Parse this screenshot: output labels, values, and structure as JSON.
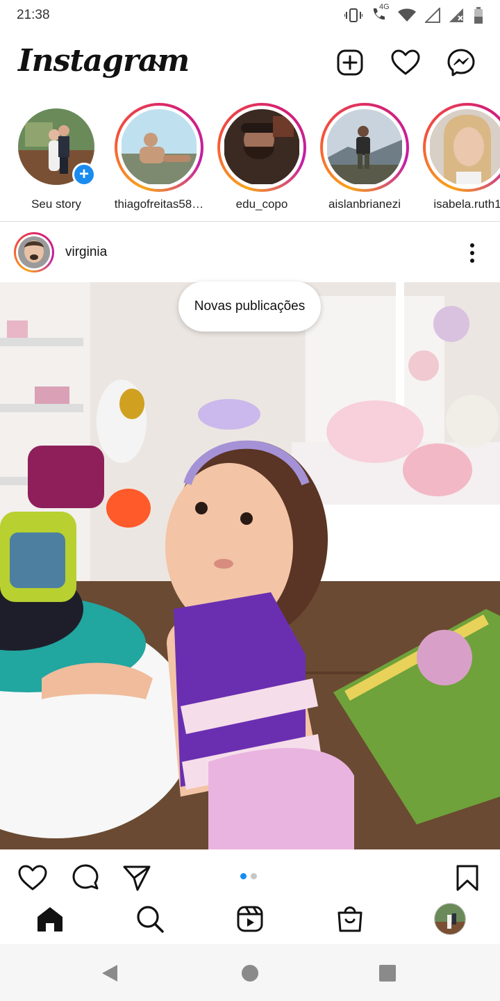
{
  "status_bar": {
    "time": "21:38",
    "network": "4G",
    "icons": [
      "vibrate-icon",
      "phone-icon",
      "wifi-icon",
      "signal-icon",
      "signal-icon",
      "battery-icon"
    ]
  },
  "header": {
    "logo_text": "Instagram",
    "icons": [
      "chevron-down-icon",
      "add-post-icon",
      "heart-icon",
      "messenger-icon"
    ]
  },
  "stories": [
    {
      "label": "Seu story",
      "own": true
    },
    {
      "label": "thiagofreitas58…"
    },
    {
      "label": "edu_copo"
    },
    {
      "label": "aislanbrianezi"
    },
    {
      "label": "isabela.ruth1"
    }
  ],
  "post": {
    "username": "virginia",
    "toast": "Novas publicações",
    "carousel_index": 1,
    "carousel_count": 2
  },
  "colors": {
    "accent": "#1a8cf0",
    "story_ring": [
      "#f9a31a",
      "#f4503c",
      "#d6236f",
      "#c11ea8"
    ]
  }
}
